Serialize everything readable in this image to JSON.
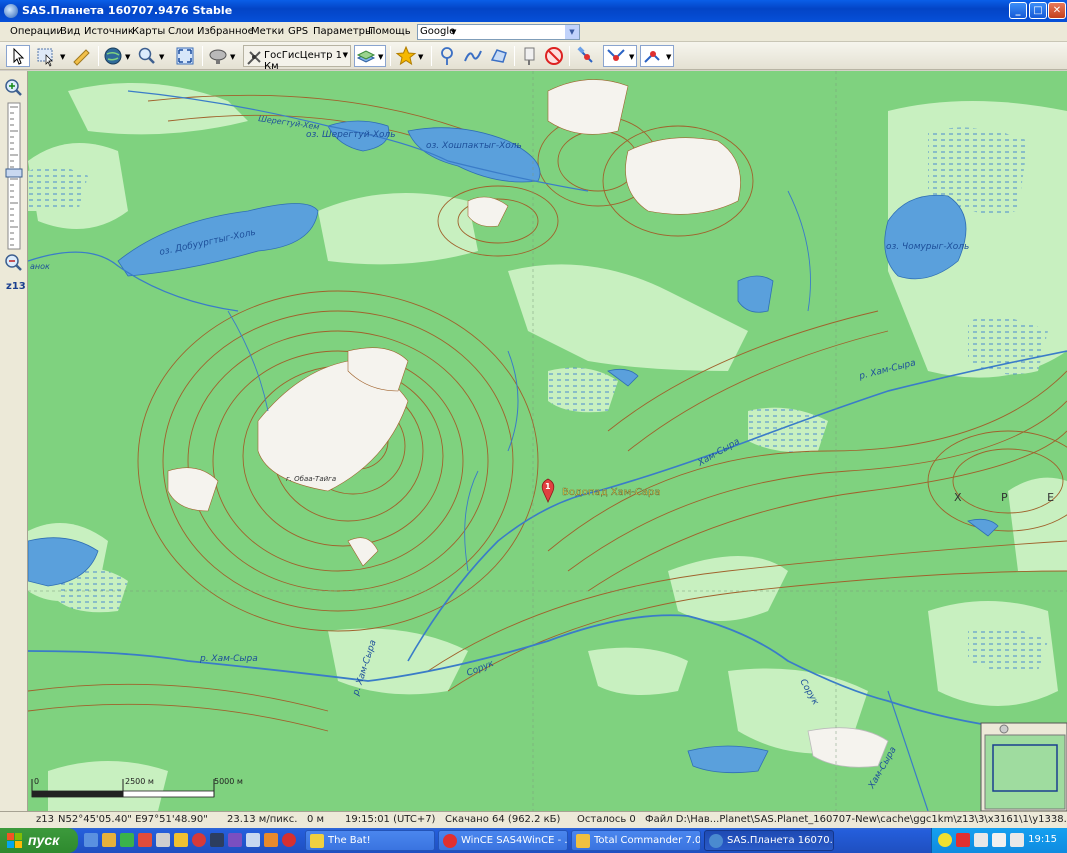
{
  "window": {
    "title": "SAS.Планета 160707.9476 Stable"
  },
  "menu": {
    "items": [
      "Операции",
      "Вид",
      "Источник",
      "Карты",
      "Слои",
      "Избранное",
      "Метки",
      "GPS",
      "Параметры",
      "Помощь"
    ],
    "layer_select": "Google"
  },
  "toolbar": {
    "map_source": "ГосГисЦентр 1 Км"
  },
  "zoom": {
    "level": "z13"
  },
  "map": {
    "labels": {
      "sheretty_lake": "оз. Шерегтуй-Холь",
      "sheretty_river": "Шерегтуй-Хем",
      "khoshkakty_lake": "оз. Хошпактыг-Холь",
      "dobuurtug_lake": "оз. Добуургтыг-Холь",
      "chomurug_lake": "оз. Чомурыг-Холь",
      "kham_syra_river": "р. Хам-Сыра",
      "kham_syra_mid": "Хам-Сыра",
      "obaa_taiga": "г. Обаа-Тайга",
      "soruk_river": "р. Хам-Сыра",
      "soruk_1": "Сорук",
      "soruk_2": "Сорук",
      "kham_syra_low": "р. Хам-Сыра",
      "kham_syra_bottom": "Хам-Сыра",
      "khre": "Х Р Е",
      "ank": "анок"
    },
    "marker": {
      "number": "1",
      "label": "Водопад Хам-Сара"
    },
    "scale": {
      "zero": "0",
      "mid": "2500 м",
      "end": "5000 м"
    }
  },
  "status": {
    "zoom": "z13",
    "coords": "N52°45'05.40\" E97°51'48.90\"",
    "resolution": "23.13 м/пикс.",
    "distance": "0 м",
    "time": "19:15:01 (UTC+7)",
    "downloaded": "Скачано 64 (962.2 кБ)",
    "remaining": "Осталось 0",
    "file": "Файл D:\\Нав...Planet\\SAS.Planet_160707-New\\cache\\ggc1km\\z13\\3\\x3161\\1\\y1338.png"
  },
  "taskbar": {
    "start": "пуск",
    "tasks": [
      "The Bat!",
      "WinCE SAS4WinCE - ...",
      "Total Commander 7.0...",
      "SAS.Планета 16070..."
    ],
    "clock": "19:15"
  },
  "colors": {
    "forest": "#7fd27f",
    "clearing": "#c8f0c0",
    "water": "#5aa0dc",
    "contour": "#a0622c",
    "river": "#3a7cc8",
    "xp_blue": "#245edb"
  }
}
